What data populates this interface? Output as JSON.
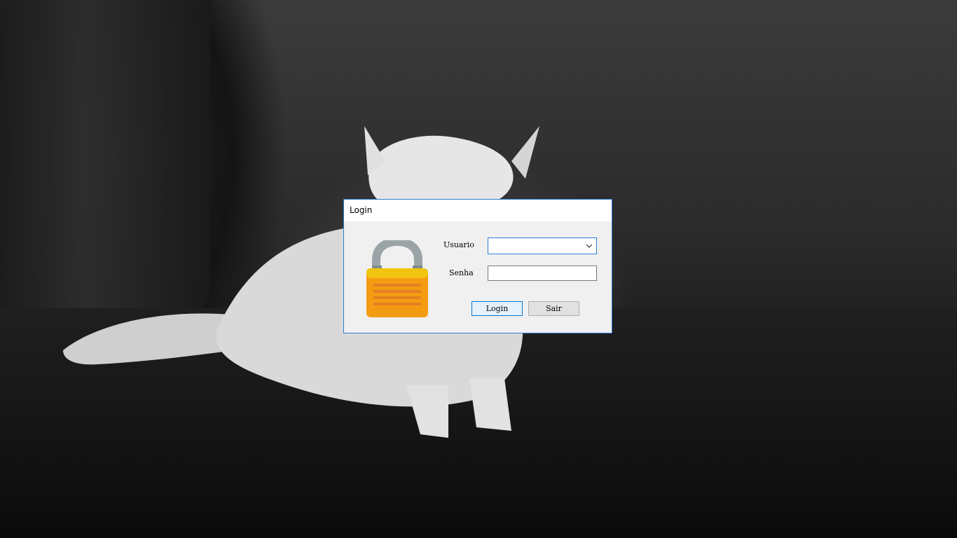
{
  "window": {
    "title": "Login"
  },
  "form": {
    "user_label": "Usuario",
    "user_value": "",
    "password_label": "Senha",
    "password_value": "",
    "login_button": "Login",
    "exit_button": "Sair"
  },
  "icons": {
    "lock": "padlock-icon",
    "dropdown": "chevron-down-icon"
  },
  "colors": {
    "accent": "#0078d7",
    "lock_body": "#f39c12",
    "lock_stripes": "#e67e22",
    "lock_shackle": "#9ba4a6"
  }
}
